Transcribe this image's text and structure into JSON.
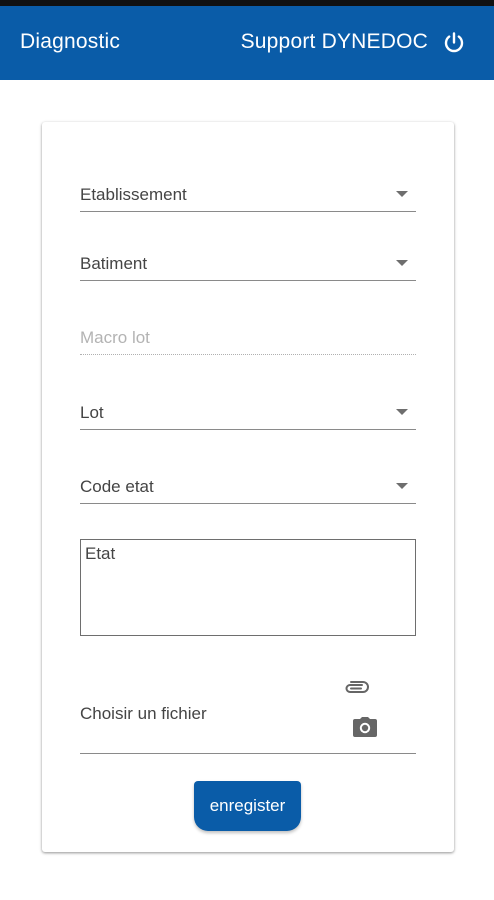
{
  "header": {
    "title": "Diagnostic",
    "support_label": "Support DYNEDOC",
    "logout_icon": "power-icon",
    "background_color": "#0a5ca8"
  },
  "form": {
    "etablissement": {
      "label": "Etablissement",
      "icon": "dropdown-arrow-icon"
    },
    "batiment": {
      "label": "Batiment",
      "icon": "dropdown-arrow-icon"
    },
    "macro_lot": {
      "placeholder": "Macro lot",
      "disabled": true
    },
    "lot": {
      "label": "Lot",
      "icon": "dropdown-arrow-icon"
    },
    "code_etat": {
      "label": "Code etat",
      "icon": "dropdown-arrow-icon"
    },
    "etat": {
      "placeholder": "Etat"
    },
    "file": {
      "label": "Choisir un fichier",
      "attach_icon": "paperclip-icon",
      "camera_icon": "camera-icon"
    },
    "submit_label": "enregister"
  }
}
